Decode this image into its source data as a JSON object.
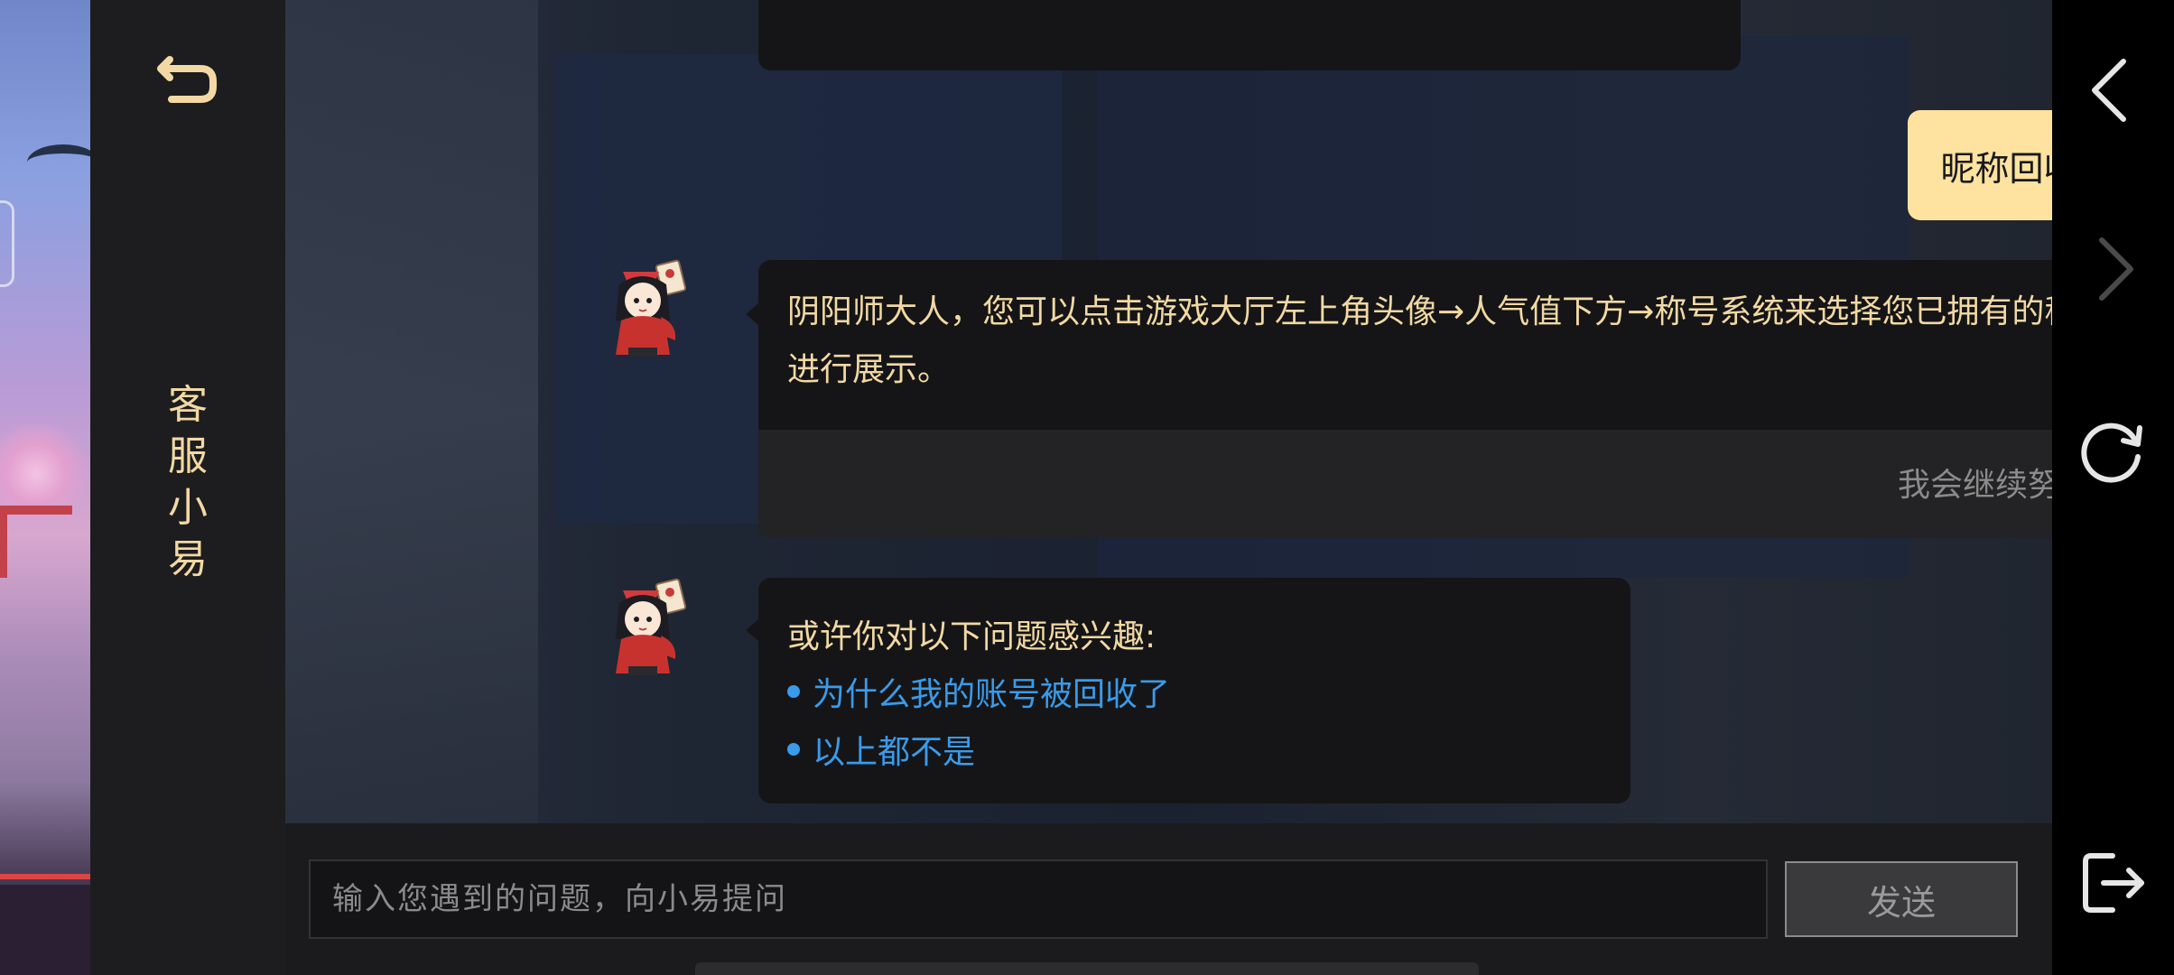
{
  "sidebar": {
    "title_chars": [
      "客",
      "服",
      "小",
      "易"
    ]
  },
  "chat": {
    "user_message": "昵称回收",
    "bot_reply": "阴阳师大人，您可以点击游戏大厅左上角头像→人气值下方→称号系统来选择您已拥有的称号进行展示。",
    "feedback_label": "我会继续努力的",
    "suggest_intro": "或许你对以下问题感兴趣:",
    "suggestions": [
      "为什么我的账号被回收了",
      "以上都不是"
    ]
  },
  "input": {
    "placeholder": "输入您遇到的问题，向小易提问",
    "send_label": "发送"
  },
  "colors": {
    "accent_gold": "#f2d9a4",
    "link_blue": "#3a9bea",
    "user_bubble": "#fde2a0"
  },
  "icons": {
    "back": "return-arrow-icon",
    "nav_back": "chevron-left-icon",
    "nav_forward": "chevron-right-icon",
    "refresh": "refresh-icon",
    "exit": "exit-icon"
  }
}
